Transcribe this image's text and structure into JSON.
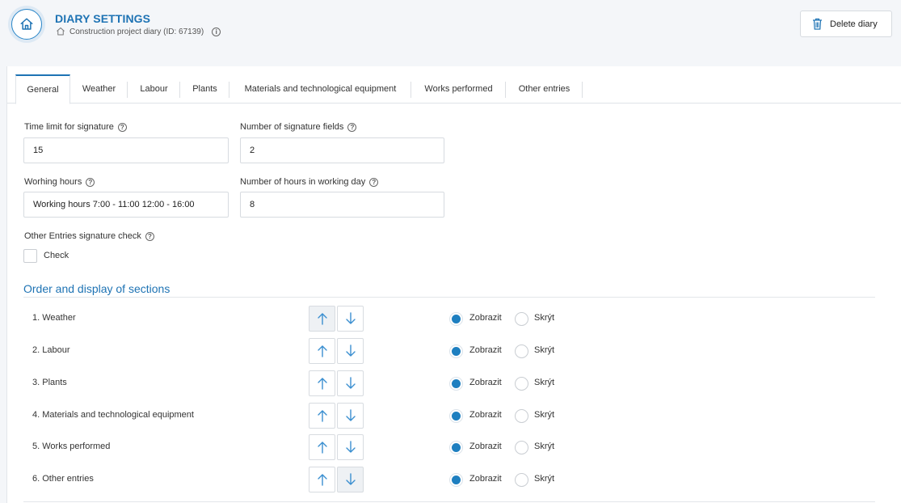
{
  "header": {
    "title": "DIARY SETTINGS",
    "subtitle": "Construction project diary (ID: 67139)",
    "delete_label": "Delete diary"
  },
  "tabs": [
    {
      "label": "General",
      "active": true
    },
    {
      "label": "Weather",
      "active": false
    },
    {
      "label": "Labour",
      "active": false
    },
    {
      "label": "Plants",
      "active": false
    },
    {
      "label": "Materials and technological equipment",
      "active": false
    },
    {
      "label": "Works performed",
      "active": false
    },
    {
      "label": "Other entries",
      "active": false
    }
  ],
  "form": {
    "time_limit_label": "Time limit for signature",
    "time_limit_value": "15",
    "signature_fields_label": "Number of signature fields",
    "signature_fields_value": "2",
    "working_hours_label": "Worhing hours",
    "working_hours_value": "Working hours 7:00 - 11:00 12:00 - 16:00",
    "hours_per_day_label": "Number of hours in working day",
    "hours_per_day_value": "8",
    "other_check_label": "Other Entries signature check",
    "check_label": "Check",
    "check_checked": false
  },
  "sections": {
    "title": "Order and display of sections",
    "show_label": "Zobrazit",
    "hide_label": "Skrýt",
    "items": [
      {
        "label": "1. Weather",
        "visible": true,
        "up_disabled": true,
        "down_disabled": false
      },
      {
        "label": "2. Labour",
        "visible": true,
        "up_disabled": false,
        "down_disabled": false
      },
      {
        "label": "3. Plants",
        "visible": true,
        "up_disabled": false,
        "down_disabled": false
      },
      {
        "label": "4. Materials and technological equipment",
        "visible": true,
        "up_disabled": false,
        "down_disabled": false
      },
      {
        "label": "5. Works performed",
        "visible": true,
        "up_disabled": false,
        "down_disabled": false
      },
      {
        "label": "6. Other entries",
        "visible": true,
        "up_disabled": false,
        "down_disabled": true
      }
    ]
  },
  "colors": {
    "accent": "#1e73b4",
    "radio_fill": "#1e7fc0"
  }
}
